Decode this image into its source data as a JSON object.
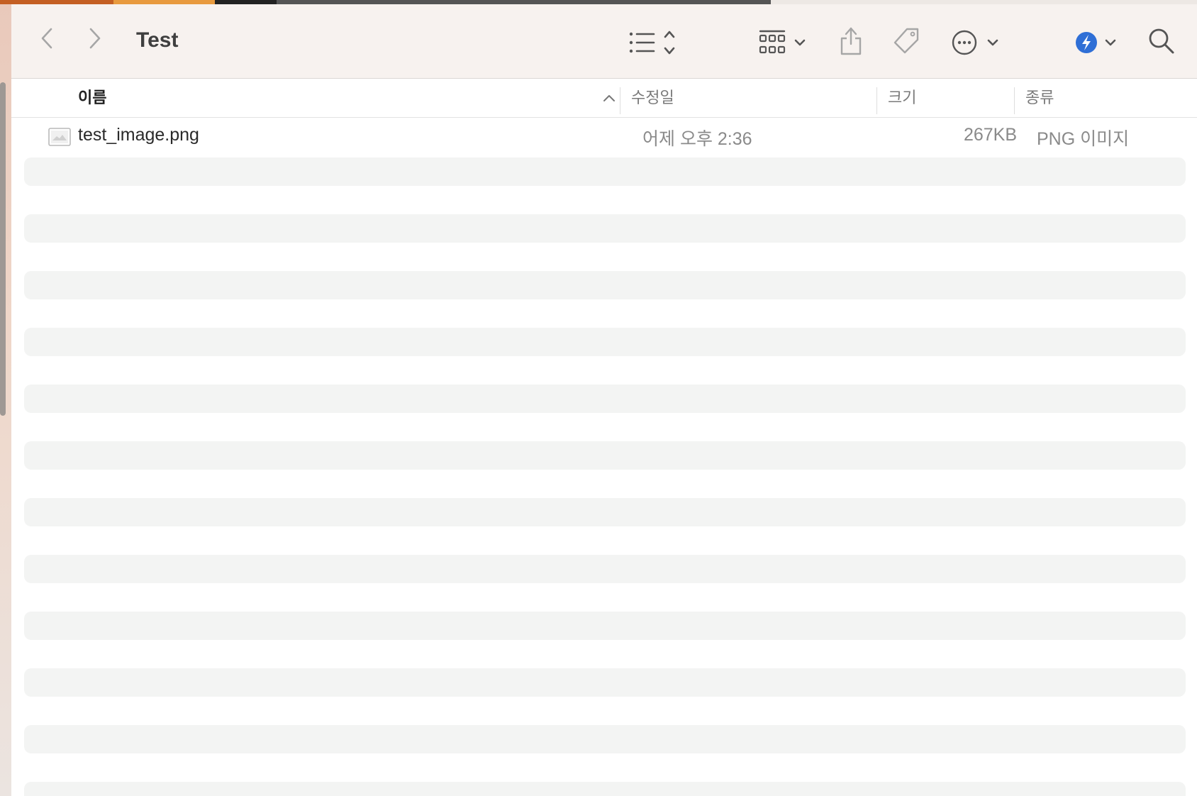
{
  "window": {
    "title": "Test"
  },
  "toolbar": {
    "back_icon": "chevron-left-icon",
    "forward_icon": "chevron-right-icon",
    "view_icon": "list-view-icon",
    "group_icon": "group-grid-icon",
    "share_icon": "share-icon",
    "tag_icon": "tag-icon",
    "action_icon": "ellipsis-circle-icon",
    "extension_icon": "shortcut-extension-icon",
    "search_icon": "search-icon",
    "extension_color": "#2f6fd6"
  },
  "columns": {
    "name": "이름",
    "modified": "수정일",
    "size": "크기",
    "kind": "종류"
  },
  "files": [
    {
      "name": "test_image.png",
      "modified": "어제 오후 2:36",
      "size": "267KB",
      "kind": "PNG 이미지",
      "icon": "image-file-icon"
    }
  ]
}
